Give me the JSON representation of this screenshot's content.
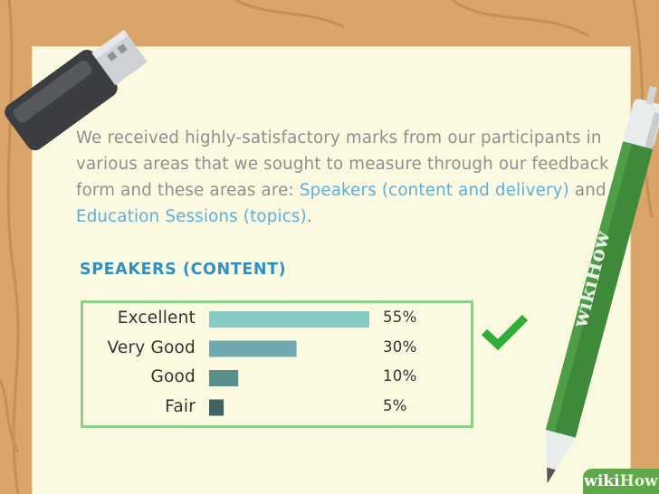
{
  "paragraph": {
    "intro": "We received highly-satisfactory marks from our participants in various areas that we sought to measure through our feedback form and these areas are: ",
    "highlight1": "Speakers (content and delivery)",
    "connector": " and ",
    "highlight2": "Education Sessions (topics)",
    "ending": "."
  },
  "chart_data": {
    "type": "bar",
    "orientation": "horizontal",
    "title": "SPEAKERS (CONTENT)",
    "categories": [
      "Excellent",
      "Very Good",
      "Good",
      "Fair"
    ],
    "values": [
      55,
      30,
      10,
      5
    ],
    "value_labels": [
      "55%",
      "30%",
      "10%",
      "5%"
    ],
    "bar_colors": [
      "#86ccc3",
      "#6fa9af",
      "#5b8f8c",
      "#3f6463"
    ],
    "xlim": [
      0,
      55
    ],
    "grid": false,
    "legend": "none"
  },
  "pen_brand": "wikiHow",
  "watermark": {
    "wiki": "wiki",
    "how": "How"
  },
  "colors": {
    "accent_blue": "#2f8fc8",
    "highlight_blue": "#5aafdc",
    "box_green": "#8cd28a",
    "check_green": "#2fae3a",
    "pen_green": "#3f8a3a"
  }
}
